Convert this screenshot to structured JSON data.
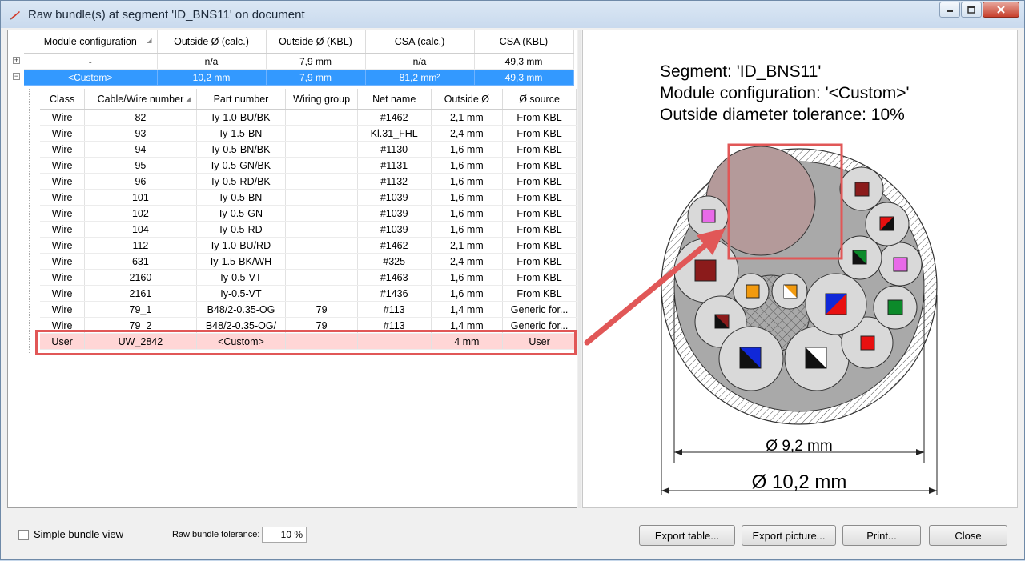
{
  "window": {
    "title": "Raw bundle(s) at segment 'ID_BNS11' on document",
    "icons": [
      "minimize-icon",
      "maximize-icon",
      "close-icon"
    ]
  },
  "bundle_grid": {
    "headers": [
      "Module configuration",
      "Outside Ø (calc.)",
      "Outside Ø (KBL)",
      "CSA (calc.)",
      "CSA (KBL)"
    ],
    "rows": [
      {
        "expander": "+",
        "module": "-",
        "od_calc": "n/a",
        "od_kbl": "7,9 mm",
        "csa_calc": "n/a",
        "csa_kbl": "49,3 mm"
      },
      {
        "expander": "−",
        "module": "<Custom>",
        "od_calc": "10,2 mm",
        "od_kbl": "7,9 mm",
        "csa_calc": "81,2 mm²",
        "csa_kbl": "49,3 mm"
      }
    ]
  },
  "wire_grid": {
    "headers": [
      "Class",
      "Cable/Wire number",
      "Part number",
      "Wiring group",
      "Net name",
      "Outside Ø",
      "Ø source"
    ],
    "rows": [
      [
        "Wire",
        "82",
        "Iy-1.0-BU/BK",
        "",
        "#1462",
        "2,1 mm",
        "From KBL"
      ],
      [
        "Wire",
        "93",
        "Iy-1.5-BN",
        "",
        "Kl.31_FHL",
        "2,4 mm",
        "From KBL"
      ],
      [
        "Wire",
        "94",
        "Iy-0.5-BN/BK",
        "",
        "#1130",
        "1,6 mm",
        "From KBL"
      ],
      [
        "Wire",
        "95",
        "Iy-0.5-GN/BK",
        "",
        "#1131",
        "1,6 mm",
        "From KBL"
      ],
      [
        "Wire",
        "96",
        "Iy-0.5-RD/BK",
        "",
        "#1132",
        "1,6 mm",
        "From KBL"
      ],
      [
        "Wire",
        "101",
        "Iy-0.5-BN",
        "",
        "#1039",
        "1,6 mm",
        "From KBL"
      ],
      [
        "Wire",
        "102",
        "Iy-0.5-GN",
        "",
        "#1039",
        "1,6 mm",
        "From KBL"
      ],
      [
        "Wire",
        "104",
        "Iy-0.5-RD",
        "",
        "#1039",
        "1,6 mm",
        "From KBL"
      ],
      [
        "Wire",
        "112",
        "Iy-1.0-BU/RD",
        "",
        "#1462",
        "2,1 mm",
        "From KBL"
      ],
      [
        "Wire",
        "631",
        "Iy-1.5-BK/WH",
        "",
        "#325",
        "2,4 mm",
        "From KBL"
      ],
      [
        "Wire",
        "2160",
        "Iy-0.5-VT",
        "",
        "#1463",
        "1,6 mm",
        "From KBL"
      ],
      [
        "Wire",
        "2161",
        "Iy-0.5-VT",
        "",
        "#1436",
        "1,6 mm",
        "From KBL"
      ],
      [
        "Wire",
        "79_1",
        "B48/2-0.35-OG",
        "79",
        "#113",
        "1,4 mm",
        "Generic for..."
      ],
      [
        "Wire",
        "79_2",
        "B48/2-0.35-OG/",
        "79",
        "#113",
        "1,4 mm",
        "Generic for..."
      ],
      [
        "User",
        "UW_2842",
        "<Custom>",
        "",
        "",
        "4 mm",
        "User"
      ]
    ]
  },
  "diagram": {
    "line1": "Segment: 'ID_BNS11'",
    "line2": "Module configuration: '<Custom>'",
    "line3": "Outside diameter tolerance: 10%",
    "inner_dim": "Ø 9,2 mm",
    "outer_dim": "Ø 10,2 mm"
  },
  "bottom": {
    "simple_view_label": "Simple bundle view",
    "simple_view_checked": false,
    "tolerance_label": "Raw bundle tolerance:",
    "tolerance_value": "10 %",
    "buttons": [
      "Export table...",
      "Export picture...",
      "Print...",
      "Close"
    ]
  },
  "colors": {
    "selection": "#3399ff",
    "highlight": "#e15757",
    "user_row": "#ffd6d6"
  }
}
